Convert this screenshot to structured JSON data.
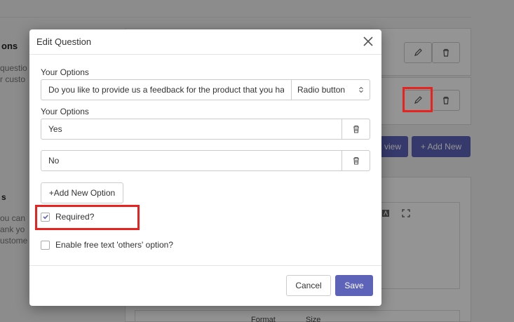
{
  "background": {
    "heading_fragment": "ons",
    "desc_lines": [
      "questio",
      "r custo"
    ],
    "section2_fragment": "s",
    "section2_lines": [
      "ou can",
      "ank yo",
      "ustome"
    ],
    "preview_fragment": "view",
    "add_new_label": "+ Add New",
    "toolbar_fragments": [
      "Format",
      "Size"
    ]
  },
  "modal": {
    "title": "Edit Question",
    "question_section_label": "Your Options",
    "question_value": "Do you like to provide us a feedback for the product that you have purchased?",
    "question_type": "Radio button",
    "options_section_label": "Your Options",
    "options": [
      {
        "value": "Yes"
      },
      {
        "value": "No"
      }
    ],
    "add_option_label": "+Add New Option",
    "required_label": "Required?",
    "required_checked": true,
    "others_label": "Enable free text 'others' option?",
    "others_checked": false,
    "cancel_label": "Cancel",
    "save_label": "Save"
  },
  "colors": {
    "primary": "#5c63b8",
    "highlight": "#e8231f"
  }
}
